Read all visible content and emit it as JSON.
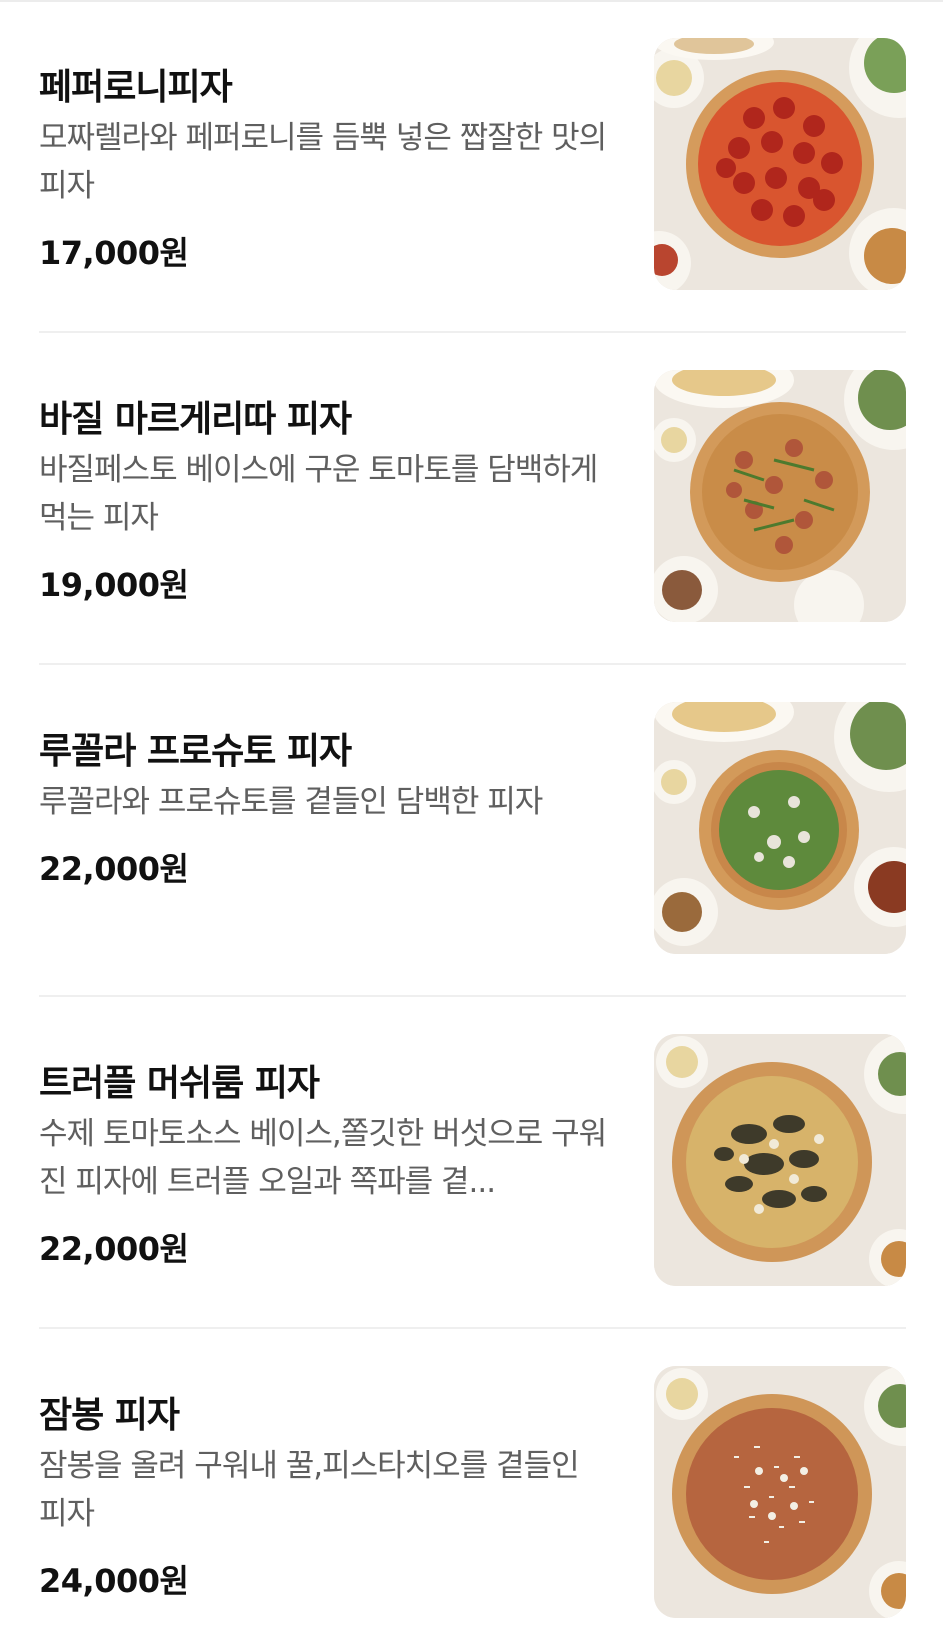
{
  "menu": [
    {
      "name": "페퍼로니피자",
      "description": "모짜렐라와 페퍼로니를 듬뿍 넣은 짭잘한 맛의 피자",
      "price": "17,000원",
      "image": "pepperoni-pizza-photo"
    },
    {
      "name": "바질 마르게리따 피자",
      "description": "바질페스토 베이스에 구운 토마토를 담백하게 먹는 피자",
      "price": "19,000원",
      "image": "basil-margherita-pizza-photo"
    },
    {
      "name": "루꼴라 프로슈토 피자",
      "description": "루꼴라와 프로슈토를 곁들인 담백한 피자",
      "price": "22,000원",
      "image": "arugula-prosciutto-pizza-photo"
    },
    {
      "name": "트러플 머쉬룸 피자",
      "description": "수제 토마토소스 베이스,쫄깃한 버섯으로 구워진 피자에 트러플 오일과 쪽파를 곁...",
      "price": "22,000원",
      "image": "truffle-mushroom-pizza-photo"
    },
    {
      "name": "잠봉 피자",
      "description": "잠봉을 올려 구워내 꿀,피스타치오를 곁들인 피자",
      "price": "24,000원",
      "image": "jambon-pizza-photo"
    }
  ]
}
